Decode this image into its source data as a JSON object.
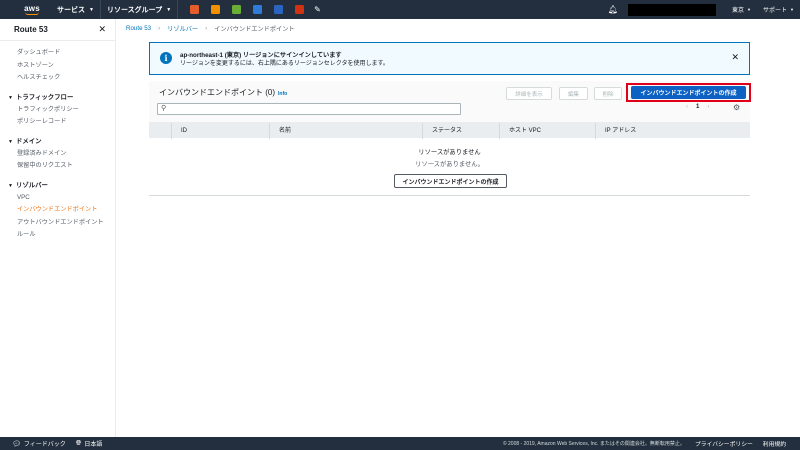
{
  "topnav": {
    "logo": "aws",
    "services": "サービス",
    "resource_groups": "リソースグループ",
    "service_icons": [
      {
        "name": "service-icon-1",
        "color": "#e45d2b"
      },
      {
        "name": "service-icon-2",
        "color": "#f29100"
      },
      {
        "name": "service-icon-3",
        "color": "#6aae35"
      },
      {
        "name": "service-icon-4",
        "color": "#2f7bd8"
      },
      {
        "name": "service-icon-5",
        "color": "#2b63c1"
      },
      {
        "name": "service-icon-6",
        "color": "#d13212"
      }
    ],
    "region": "東京",
    "support": "サポート"
  },
  "sidebar": {
    "title": "Route 53",
    "top_items": [
      "ダッシュボード",
      "ホストゾーン",
      "ヘルスチェック"
    ],
    "sections": [
      {
        "label": "トラフィックフロー",
        "items": [
          {
            "label": "トラフィックポリシー"
          },
          {
            "label": "ポリシーレコード"
          }
        ]
      },
      {
        "label": "ドメイン",
        "items": [
          {
            "label": "登録済みドメイン"
          },
          {
            "label": "保留中のリクエスト"
          }
        ]
      },
      {
        "label": "リゾルバー",
        "items": [
          {
            "label": "VPC"
          },
          {
            "label": "インバウンドエンドポイント",
            "active": true
          },
          {
            "label": "アウトバウンドエンドポイント"
          },
          {
            "label": "ルール"
          }
        ]
      }
    ]
  },
  "breadcrumb": {
    "root": "Route 53",
    "parent": "リゾルバー",
    "current": "インバウンドエンドポイント"
  },
  "alert": {
    "title": "ap-northeast-1 (東京) リージョンにサインインしています",
    "body": "リージョンを変更するには、右上隅にあるリージョンセレクタを使用します。"
  },
  "panel": {
    "title": "インバウンドエンドポイント (0)",
    "info": "Info",
    "view_details": "詳細を表示",
    "edit": "編集",
    "delete": "削除",
    "create": "インバウンドエンドポイントの作成",
    "page": "1",
    "columns": [
      "ID",
      "名前",
      "ステータス",
      "ホスト VPC",
      "IP アドレス"
    ],
    "empty_title": "リソースがありません",
    "empty_body": "リソースがありません。",
    "empty_create": "インバウンドエンドポイントの作成"
  },
  "footer": {
    "feedback": "フィードバック",
    "language": "日本語",
    "copyright": "© 2008 - 2019, Amazon Web Services, Inc. またはその関連会社。無断転用禁止。",
    "privacy": "プライバシーポリシー",
    "terms": "利用規約"
  }
}
